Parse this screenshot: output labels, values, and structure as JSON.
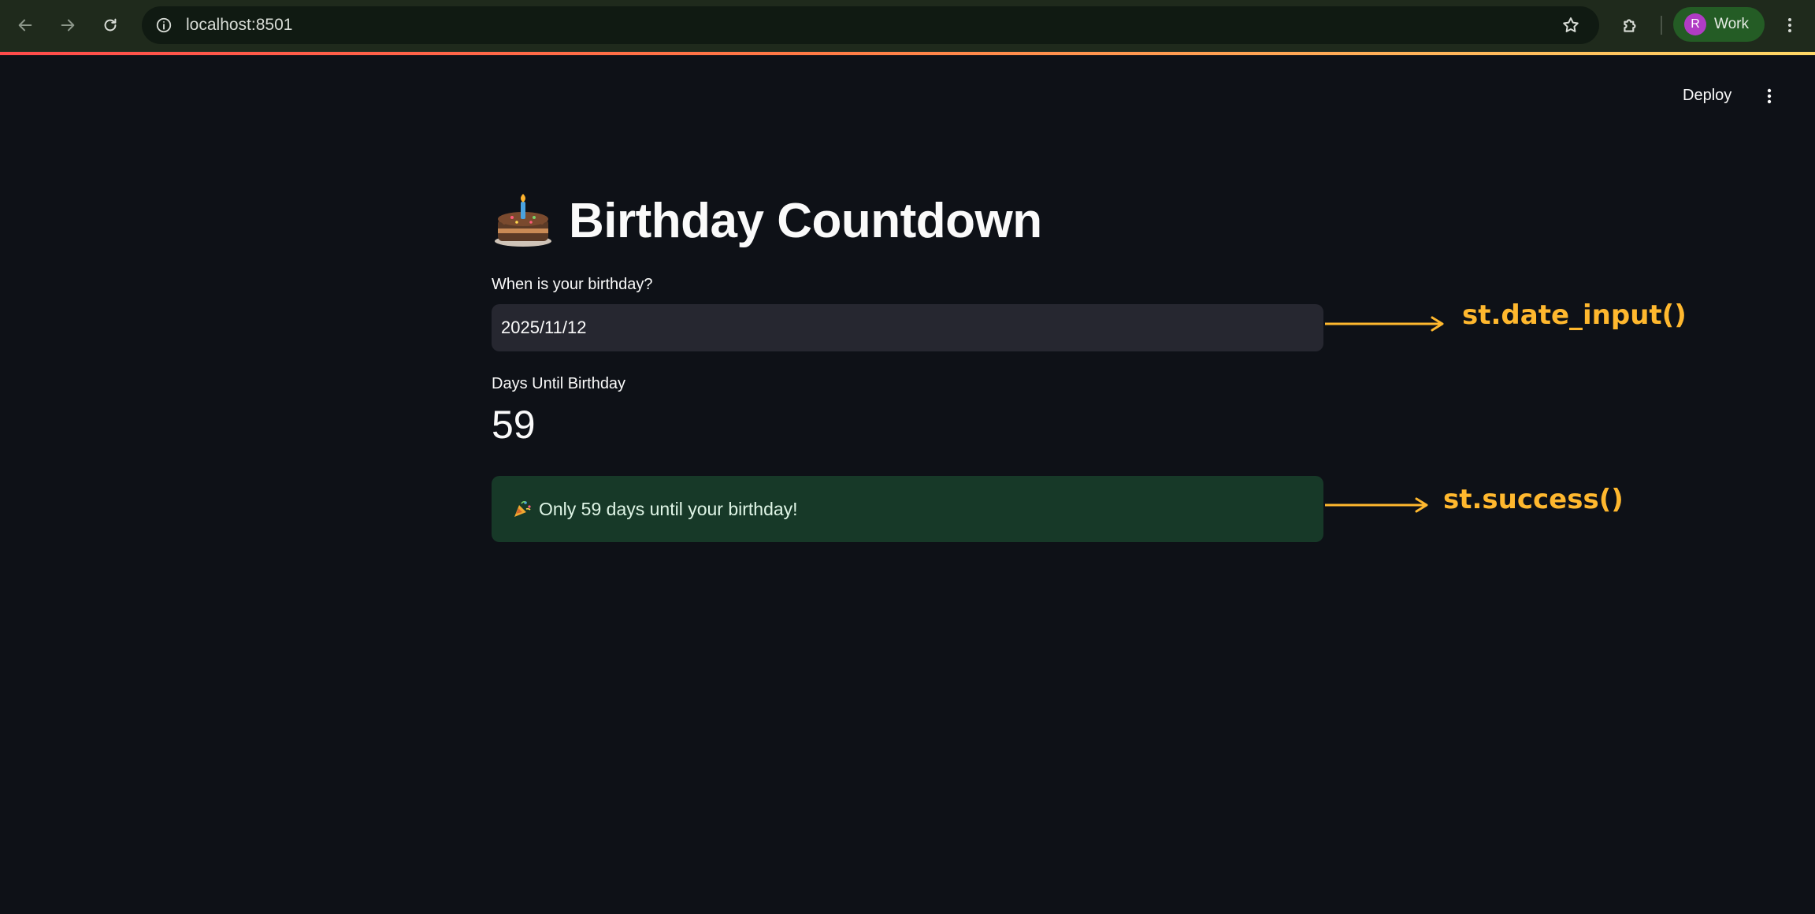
{
  "browser": {
    "url": "localhost:8501",
    "profile_initial": "R",
    "profile_name": "Work"
  },
  "header": {
    "deploy_label": "Deploy"
  },
  "main": {
    "title": "Birthday Countdown",
    "date_input": {
      "label": "When is your birthday?",
      "value": "2025/11/12"
    },
    "metric": {
      "label": "Days Until Birthday",
      "value": "59"
    },
    "success_message": "Only 59 days until your birthday!"
  },
  "annotations": {
    "date_input": "st.date_input()",
    "success": "st.success()"
  },
  "colors": {
    "background": "#0e1117",
    "input_bg": "#262730",
    "success_bg": "#173928",
    "annotation": "#ffb82e",
    "accent": "#ff4b4b"
  }
}
